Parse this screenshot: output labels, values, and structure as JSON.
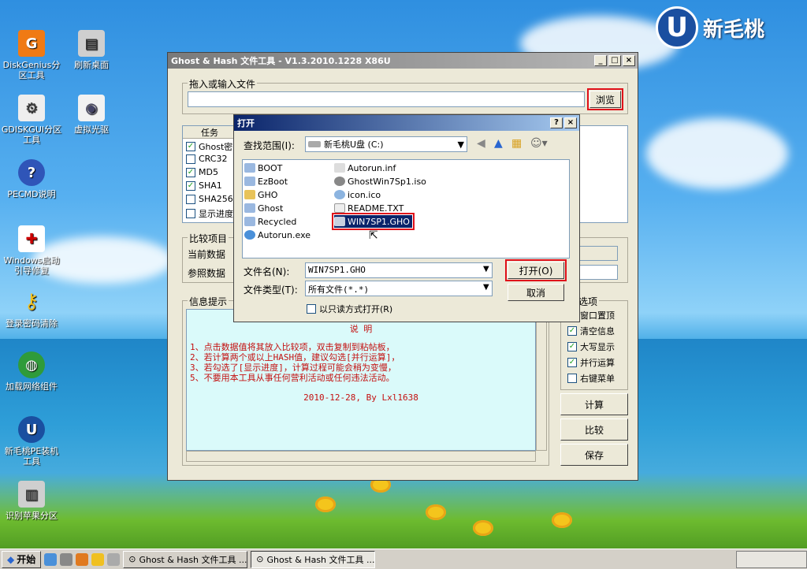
{
  "desktop": {
    "icons": [
      {
        "label": "DiskGenius分\n区工具"
      },
      {
        "label": "刷新桌面"
      },
      {
        "label": "GDISKGUI分区\n工具"
      },
      {
        "label": "虚拟光驱"
      },
      {
        "label": "PECMD说明"
      },
      {
        "label": "Windows启动\n引导修复"
      },
      {
        "label": "登录密码清除"
      },
      {
        "label": "加载网络组件"
      },
      {
        "label": "新毛桃PE装机\n工具"
      },
      {
        "label": "识别苹果分区"
      }
    ],
    "logo_text": "新毛桃",
    "logo_mark": "U"
  },
  "main_window": {
    "title": "Ghost & Hash 文件工具 - V1.3.2010.1228 X86U",
    "input_group_label": "拖入或输入文件",
    "file_input_value": "",
    "browse_label": "浏览",
    "task_header": "任务",
    "tasks": [
      {
        "label": "Ghost密",
        "checked": true
      },
      {
        "label": "CRC32",
        "checked": false
      },
      {
        "label": "MD5",
        "checked": true
      },
      {
        "label": "SHA1",
        "checked": true
      },
      {
        "label": "SHA256",
        "checked": false
      },
      {
        "label": "显示进度",
        "checked": false
      }
    ],
    "compare_group_label": "比较项目",
    "current_data_label": "当前数据",
    "reference_data_label": "参照数据",
    "info_group_label": "信息提示",
    "info_title": "说 明",
    "info_lines": [
      "1、点击数据值将其放入比较项，双击复制到粘帖板，",
      "2、若计算两个或以上HASH值，建议勾选[并行运算]，",
      "3、若勾选了[显示进度]，计算过程可能会稍为变慢，",
      "5、不要用本工具从事任何营利活动或任何违法活动。"
    ],
    "info_date": "2010-12-28, By Lxl1638",
    "options_group_label": "选项",
    "options": [
      {
        "label": "窗口置顶",
        "checked": false
      },
      {
        "label": "清空信息",
        "checked": true
      },
      {
        "label": "大写显示",
        "checked": true
      },
      {
        "label": "并行运算",
        "checked": true
      },
      {
        "label": "右键菜单",
        "checked": false
      }
    ],
    "compute_label": "计算",
    "compare_label": "比较",
    "save_label": "保存"
  },
  "open_dialog": {
    "title": "打开",
    "look_in_label": "查找范围(I):",
    "look_in_value": "新毛桃U盘 (C:)",
    "files_col1": [
      "BOOT",
      "EzBoot",
      "GHO",
      "Ghost",
      "Recycled",
      "Autorun.exe"
    ],
    "files_col2": [
      "Autorun.inf",
      "GhostWin7Sp1.iso",
      "icon.ico",
      "README.TXT",
      "WIN7SP1.GHO"
    ],
    "selected_file": "WIN7SP1.GHO",
    "filename_label": "文件名(N):",
    "filename_value": "WIN7SP1.GHO",
    "filetype_label": "文件类型(T):",
    "filetype_value": "所有文件(*.*)",
    "readonly_label": "以只读方式打开(R)",
    "open_label": "打开(O)",
    "cancel_label": "取消"
  },
  "taskbar": {
    "start_label": "开始",
    "tasks": [
      "Ghost & Hash 文件工具 ...",
      "Ghost & Hash 文件工具 ..."
    ]
  },
  "colors": {
    "accent_red": "#e0101a",
    "title_active": "#0a246a"
  }
}
